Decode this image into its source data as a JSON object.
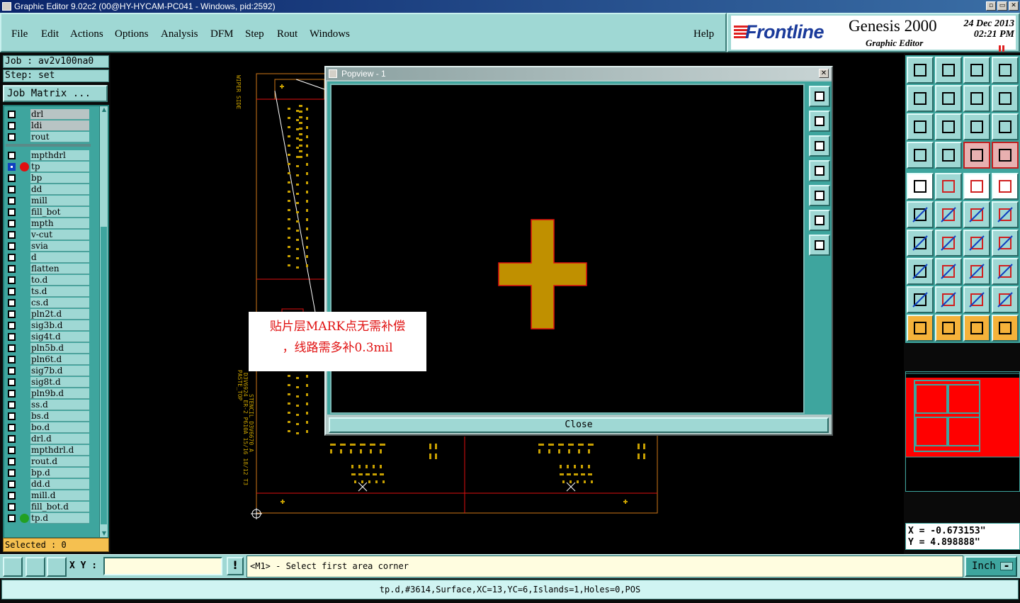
{
  "window": {
    "title": "Graphic Editor 9.02c2 (00@HY-HYCAM-PC041 - Windows, pid:2592)",
    "controls": [
      "▫",
      "▭",
      "✕"
    ]
  },
  "menu": {
    "items": [
      "File",
      "Edit",
      "Actions",
      "Options",
      "Analysis",
      "DFM",
      "Step",
      "Rout",
      "Windows"
    ],
    "help": "Help"
  },
  "brand": {
    "logo": "Frontline",
    "product": "Genesis 2000",
    "subtitle": "Graphic Editor",
    "date": "24 Dec 2013",
    "time": "02:21 PM"
  },
  "job": {
    "job_line": "Job : av2v100na0",
    "step_line": "Step: set",
    "matrix_button": "Job Matrix ..."
  },
  "layers": [
    {
      "name": "drl",
      "gray": true
    },
    {
      "name": "ldi",
      "gray": true
    },
    {
      "name": "rout",
      "gray": false
    },
    {
      "name": "mpthdrl"
    },
    {
      "name": "tp",
      "active": true,
      "dot": "#e01010"
    },
    {
      "name": "bp"
    },
    {
      "name": "dd"
    },
    {
      "name": "mill"
    },
    {
      "name": "fill_bot"
    },
    {
      "name": "mpth"
    },
    {
      "name": "v-cut"
    },
    {
      "name": "svia"
    },
    {
      "name": "d"
    },
    {
      "name": "flatten"
    },
    {
      "name": "to.d"
    },
    {
      "name": "ts.d"
    },
    {
      "name": "cs.d"
    },
    {
      "name": "pln2t.d"
    },
    {
      "name": "sig3b.d"
    },
    {
      "name": "sig4t.d"
    },
    {
      "name": "pln5b.d"
    },
    {
      "name": "pln6t.d"
    },
    {
      "name": "sig7b.d"
    },
    {
      "name": "sig8t.d"
    },
    {
      "name": "pln9b.d"
    },
    {
      "name": "ss.d"
    },
    {
      "name": "bs.d"
    },
    {
      "name": "bo.d"
    },
    {
      "name": "drl.d"
    },
    {
      "name": "mpthdrl.d"
    },
    {
      "name": "rout.d"
    },
    {
      "name": "bp.d"
    },
    {
      "name": "dd.d"
    },
    {
      "name": "mill.d"
    },
    {
      "name": "fill_bot.d"
    },
    {
      "name": "tp.d",
      "dot": "#22a022"
    }
  ],
  "selected": "Selected : 0",
  "popview": {
    "title": "Popview - 1",
    "close_button": "Close"
  },
  "annotation": {
    "line1": "贴片层MARK点无需补偿",
    "line2": "，线路需多补0.3mil"
  },
  "canvas_text": {
    "wiper": "WIPER SIDE",
    "paste": "PASTE_TOP",
    "stencil": "D3V6924 ER-2 P610A 15/16 18/12 T3",
    "stencil2": "STENCIL D3V6670 A"
  },
  "coords": {
    "x": "X = -0.673153\"",
    "y": "Y = 4.898888\""
  },
  "bottom": {
    "xy_label": "X Y :",
    "xy_value": "",
    "excl": "!",
    "prompt": "<M1> - Select first area corner",
    "unit": "Inch"
  },
  "status": "tp.d,#3614,Surface,XC=13,YC=6,Islands=1,Holes=0,POS",
  "colors": {
    "panel": "#9fd8d4",
    "panel_dark": "#3ea59e",
    "copper": "#c8a000",
    "board_outline": "#d07818",
    "annotation": "#e01010"
  }
}
